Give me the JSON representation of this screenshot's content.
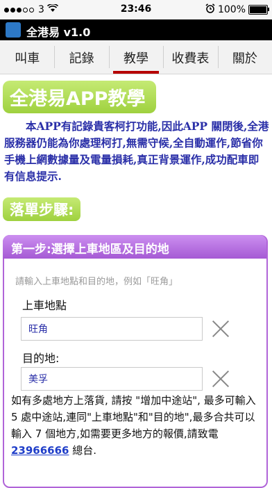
{
  "status_bar": {
    "carrier": "3",
    "time": "23:46",
    "battery": "100%"
  },
  "app": {
    "title": "全港易 v1.0"
  },
  "tabs": [
    {
      "label": "叫車"
    },
    {
      "label": "記錄"
    },
    {
      "label": "教學"
    },
    {
      "label": "收費表"
    },
    {
      "label": "關於"
    }
  ],
  "main": {
    "title": "全港易APP教學",
    "intro": "本APP有記錄貴客柯打功能,因此APP 關閉後,全港服務器仍能為你處理柯打,無需守候,全自動運作,節省你手機上網數據量及電量損耗,真正背景運作,成功配車即有信息提示.",
    "steps_title": "落單步驟:",
    "step1": {
      "header": "第一步:選擇上車地區及目的地",
      "hint": "請輸入上車地點和目的地，例如「旺角」",
      "pickup_label": "上車地點",
      "pickup_value": "旺角",
      "dest_label": "目的地:",
      "dest_value": "美孚",
      "note": "如有多處地方上落貨, 請按 \"增加中途站\", 最多可輸入 5 處中途站,連同\"上車地點\"和\"目的地\",最多合共可以輸入 7 個地方,如需要更多地方的報價,請致電",
      "phone": "23966666",
      "note_end": " 總台."
    }
  }
}
